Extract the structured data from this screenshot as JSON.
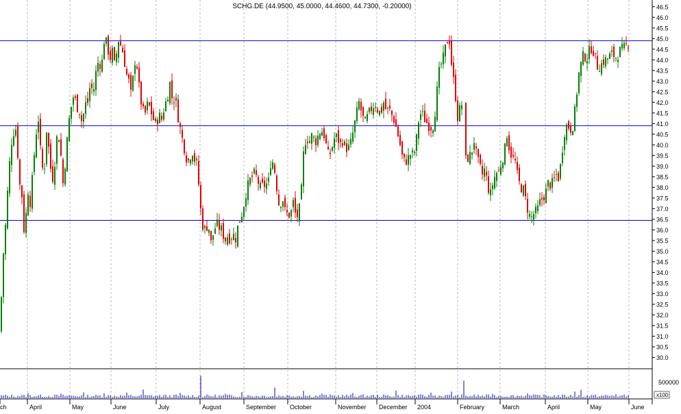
{
  "title": "SCHG.DE (44.9500, 45.0000, 44.4600, 44.7300, -0.20000)",
  "colors": {
    "up": "#008000",
    "down": "#e00000",
    "trendline": "#0000cc",
    "volume": "#0000cc",
    "grid": "#bbbbbb",
    "axis": "#000000"
  },
  "chart_data": {
    "type": "candlestick",
    "price_axis": {
      "min": 29.5,
      "max": 46.75,
      "ticks": [
        "30.0",
        "30.5",
        "31.0",
        "31.5",
        "32.0",
        "32.5",
        "33.0",
        "33.5",
        "34.0",
        "34.5",
        "35.0",
        "35.5",
        "36.0",
        "36.5",
        "37.0",
        "37.5",
        "38.0",
        "38.5",
        "39.0",
        "39.5",
        "40.0",
        "40.5",
        "41.0",
        "41.5",
        "42.0",
        "42.5",
        "43.0",
        "43.5",
        "44.0",
        "44.5",
        "45.0",
        "45.5",
        "46.0",
        "46.5"
      ]
    },
    "volume_axis": {
      "tick_label": "500000",
      "unit_label": "x100",
      "max": 1100000
    },
    "x_labels": [
      "ch",
      "April",
      "May",
      "June",
      "July",
      "August",
      "September",
      "October",
      "November",
      "December",
      "2004",
      "February",
      "March",
      "April",
      "May",
      "June"
    ],
    "horizontal_lines": [
      44.9,
      40.9,
      36.45
    ],
    "guide_series": {
      "name": "close",
      "points": [
        [
          0,
          31.2
        ],
        [
          4,
          34.5
        ],
        [
          8,
          36.2
        ],
        [
          12,
          38.3
        ],
        [
          16,
          40.0
        ],
        [
          20,
          40.6
        ],
        [
          24,
          40.8
        ],
        [
          28,
          38.3
        ],
        [
          32,
          37.6
        ],
        [
          36,
          35.5
        ],
        [
          40,
          38.0
        ],
        [
          44,
          37.3
        ],
        [
          48,
          38.7
        ],
        [
          52,
          40.4
        ],
        [
          56,
          41.2
        ],
        [
          60,
          39.3
        ],
        [
          64,
          38.5
        ],
        [
          68,
          40.7
        ],
        [
          72,
          39.6
        ],
        [
          76,
          38.2
        ],
        [
          80,
          39.2
        ],
        [
          84,
          40.7
        ],
        [
          88,
          39.9
        ],
        [
          92,
          38.2
        ],
        [
          96,
          39.4
        ],
        [
          100,
          41.0
        ],
        [
          104,
          41.8
        ],
        [
          108,
          42.4
        ],
        [
          112,
          41.8
        ],
        [
          116,
          41.6
        ],
        [
          120,
          41.0
        ],
        [
          124,
          41.9
        ],
        [
          128,
          42.0
        ],
        [
          132,
          42.9
        ],
        [
          136,
          42.4
        ],
        [
          140,
          43.4
        ],
        [
          144,
          44.0
        ],
        [
          148,
          43.6
        ],
        [
          152,
          44.9
        ],
        [
          156,
          44.8
        ],
        [
          160,
          44.0
        ],
        [
          164,
          44.4
        ],
        [
          168,
          43.6
        ],
        [
          172,
          45.0
        ],
        [
          176,
          44.7
        ],
        [
          180,
          44.3
        ],
        [
          184,
          43.4
        ],
        [
          188,
          43.0
        ],
        [
          192,
          42.2
        ],
        [
          196,
          44.0
        ],
        [
          200,
          43.7
        ],
        [
          204,
          42.4
        ],
        [
          208,
          41.6
        ],
        [
          212,
          41.5
        ],
        [
          216,
          42.0
        ],
        [
          220,
          41.6
        ],
        [
          224,
          41.2
        ],
        [
          228,
          41.0
        ],
        [
          232,
          41.4
        ],
        [
          236,
          41.2
        ],
        [
          240,
          41.8
        ],
        [
          244,
          42.2
        ],
        [
          248,
          42.9
        ],
        [
          252,
          42.0
        ],
        [
          256,
          42.3
        ],
        [
          260,
          41.3
        ],
        [
          264,
          40.6
        ],
        [
          268,
          40.0
        ],
        [
          272,
          39.4
        ],
        [
          276,
          39.2
        ],
        [
          280,
          39.8
        ],
        [
          284,
          39.3
        ],
        [
          288,
          39.1
        ],
        [
          292,
          37.2
        ],
        [
          296,
          36.2
        ],
        [
          300,
          36.0
        ],
        [
          304,
          36.3
        ],
        [
          308,
          35.4
        ],
        [
          312,
          35.9
        ],
        [
          316,
          36.3
        ],
        [
          320,
          36.1
        ],
        [
          324,
          36.0
        ],
        [
          328,
          35.5
        ],
        [
          332,
          35.7
        ],
        [
          336,
          35.6
        ],
        [
          340,
          35.8
        ],
        [
          344,
          35.6
        ],
        [
          348,
          36.3
        ],
        [
          352,
          36.6
        ],
        [
          356,
          37.2
        ],
        [
          360,
          37.9
        ],
        [
          364,
          38.3
        ],
        [
          368,
          38.5
        ],
        [
          372,
          38.7
        ],
        [
          376,
          38.3
        ],
        [
          380,
          38.0
        ],
        [
          384,
          38.1
        ],
        [
          388,
          38.1
        ],
        [
          392,
          38.3
        ],
        [
          396,
          39.4
        ],
        [
          400,
          39.0
        ],
        [
          404,
          38.0
        ],
        [
          408,
          37.0
        ],
        [
          412,
          37.6
        ],
        [
          416,
          36.9
        ],
        [
          420,
          36.7
        ],
        [
          424,
          36.7
        ],
        [
          428,
          37.3
        ],
        [
          432,
          36.6
        ],
        [
          436,
          36.7
        ],
        [
          440,
          37.9
        ],
        [
          444,
          40.1
        ],
        [
          448,
          40.3
        ],
        [
          452,
          40.2
        ],
        [
          456,
          40.5
        ],
        [
          460,
          40.1
        ],
        [
          464,
          40.4
        ],
        [
          468,
          40.7
        ],
        [
          472,
          40.6
        ],
        [
          476,
          40.0
        ],
        [
          480,
          39.4
        ],
        [
          484,
          39.8
        ],
        [
          488,
          40.3
        ],
        [
          492,
          40.4
        ],
        [
          496,
          40.0
        ],
        [
          500,
          40.2
        ],
        [
          504,
          39.9
        ],
        [
          508,
          39.8
        ],
        [
          512,
          40.1
        ],
        [
          516,
          40.7
        ],
        [
          520,
          41.4
        ],
        [
          524,
          42.0
        ],
        [
          528,
          41.5
        ],
        [
          532,
          41.0
        ],
        [
          536,
          41.3
        ],
        [
          540,
          41.6
        ],
        [
          544,
          41.8
        ],
        [
          548,
          41.9
        ],
        [
          552,
          41.6
        ],
        [
          556,
          41.5
        ],
        [
          560,
          42.0
        ],
        [
          564,
          41.6
        ],
        [
          568,
          41.7
        ],
        [
          572,
          41.4
        ],
        [
          576,
          41.1
        ],
        [
          580,
          40.6
        ],
        [
          584,
          40.0
        ],
        [
          588,
          39.3
        ],
        [
          592,
          39.2
        ],
        [
          596,
          39.4
        ],
        [
          600,
          39.6
        ],
        [
          604,
          39.5
        ],
        [
          608,
          40.3
        ],
        [
          612,
          41.4
        ],
        [
          616,
          41.5
        ],
        [
          620,
          41.2
        ],
        [
          624,
          41.0
        ],
        [
          628,
          40.8
        ],
        [
          632,
          40.9
        ],
        [
          636,
          41.8
        ],
        [
          640,
          43.3
        ],
        [
          644,
          43.8
        ],
        [
          648,
          44.2
        ],
        [
          652,
          44.9
        ],
        [
          656,
          44.9
        ],
        [
          660,
          43.5
        ],
        [
          664,
          42.6
        ],
        [
          668,
          41.3
        ],
        [
          672,
          41.8
        ],
        [
          676,
          42.0
        ],
        [
          680,
          39.3
        ],
        [
          684,
          39.4
        ],
        [
          688,
          39.6
        ],
        [
          692,
          40.2
        ],
        [
          696,
          39.4
        ],
        [
          700,
          39.0
        ],
        [
          704,
          38.6
        ],
        [
          708,
          38.9
        ],
        [
          712,
          38.0
        ],
        [
          716,
          37.7
        ],
        [
          720,
          38.3
        ],
        [
          724,
          38.7
        ],
        [
          728,
          38.7
        ],
        [
          732,
          39.2
        ],
        [
          736,
          39.6
        ],
        [
          740,
          40.5
        ],
        [
          744,
          39.7
        ],
        [
          748,
          39.4
        ],
        [
          752,
          39.2
        ],
        [
          756,
          38.4
        ],
        [
          760,
          38.0
        ],
        [
          764,
          37.9
        ],
        [
          768,
          37.3
        ],
        [
          772,
          36.7
        ],
        [
          776,
          36.6
        ],
        [
          780,
          36.8
        ],
        [
          784,
          36.9
        ],
        [
          788,
          37.3
        ],
        [
          792,
          37.5
        ],
        [
          796,
          37.7
        ],
        [
          800,
          38.2
        ],
        [
          804,
          38.1
        ],
        [
          808,
          38.3
        ],
        [
          812,
          38.6
        ],
        [
          816,
          38.4
        ],
        [
          820,
          39.6
        ],
        [
          824,
          40.6
        ],
        [
          828,
          41.0
        ],
        [
          832,
          40.7
        ],
        [
          836,
          40.9
        ],
        [
          840,
          41.8
        ],
        [
          844,
          43.2
        ],
        [
          848,
          43.8
        ],
        [
          852,
          44.3
        ],
        [
          856,
          44.0
        ],
        [
          860,
          44.4
        ],
        [
          864,
          44.6
        ],
        [
          868,
          44.2
        ],
        [
          872,
          43.7
        ],
        [
          876,
          43.7
        ],
        [
          880,
          43.9
        ],
        [
          884,
          44.0
        ],
        [
          888,
          44.1
        ],
        [
          892,
          44.3
        ],
        [
          896,
          44.2
        ],
        [
          900,
          44.1
        ],
        [
          904,
          44.4
        ],
        [
          908,
          44.5
        ],
        [
          912,
          44.6
        ],
        [
          916,
          44.75
        ]
      ]
    },
    "volume_series": {
      "name": "volume",
      "spikes": [
        [
          292,
          880000
        ],
        [
          676,
          690000
        ],
        [
          400,
          420000
        ],
        [
          208,
          340000
        ],
        [
          848,
          330000
        ],
        [
          578,
          300000
        ],
        [
          442,
          290000
        ],
        [
          660,
          260000
        ],
        [
          122,
          230000
        ],
        [
          184,
          220000
        ],
        [
          262,
          210000
        ],
        [
          352,
          240000
        ],
        [
          516,
          200000
        ],
        [
          628,
          220000
        ],
        [
          770,
          190000
        ],
        [
          838,
          260000
        ],
        [
          88,
          180000
        ],
        [
          40,
          200000
        ],
        [
          152,
          190000
        ],
        [
          330,
          170000
        ],
        [
          470,
          180000
        ],
        [
          720,
          170000
        ],
        [
          900,
          160000
        ]
      ]
    }
  }
}
